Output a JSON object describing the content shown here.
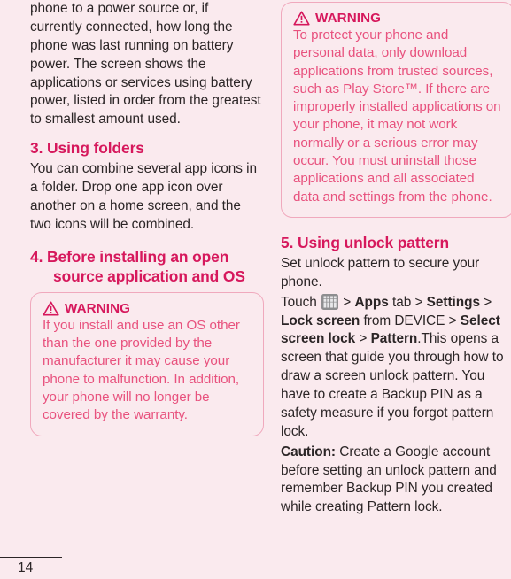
{
  "page": {
    "number": "14",
    "background_color": "#faeaee",
    "heading_color": "#d6185c",
    "body_text_color": "#2b2526",
    "warning_text_color": "#e8527e",
    "warning_border_color": "#f0a9bd"
  },
  "left_column": {
    "continued_paragraph": "phone to a power source or, if currently connected, how long the phone was last running on battery power. The screen shows the applications or services using battery power, listed in order from the greatest to smallest amount used.",
    "section3": {
      "heading": "3. Using folders",
      "paragraph": "You can combine several app icons in a folder. Drop one app icon over another on a home screen, and the two icons will be combined."
    },
    "section4": {
      "heading": "4. Before installing an open source application and OS",
      "warning": {
        "icon": "warning-triangle-icon",
        "label": "WARNING",
        "text": "If you install and use an OS other than the one provided by the manufacturer it may cause your phone to malfunction. In addition, your phone will no longer be covered by the warranty."
      }
    }
  },
  "right_column": {
    "warning": {
      "icon": "warning-triangle-icon",
      "label": "WARNING",
      "text": "To protect your phone and personal data, only download applications from trusted sources, such as Play Store™. If there are improperly installed applications on your phone, it may not work normally or a serious error may occur. You must uninstall those applications and all associated data and settings from the phone."
    },
    "section5": {
      "heading": "5. Using unlock pattern",
      "intro": "Set unlock pattern to secure your phone.",
      "path": {
        "touch_label": "Touch",
        "apps_icon": "apps-grid-icon",
        "sep": ">",
        "step1_bold": "Apps",
        "step1_rest": "tab",
        "step2_bold": "Settings",
        "step3_bold": "Lock screen",
        "step3_rest": "from DEVICE",
        "step4_bold": "Select screen lock",
        "step5_bold": "Pattern",
        "trailing": ".This opens a screen that guide you through how to draw a screen unlock pattern. You have to create a Backup PIN as a safety measure if you forgot pattern lock."
      },
      "caution": {
        "label": "Caution:",
        "text": "Create a Google account before setting an unlock pattern and remember Backup PIN you created while creating Pattern lock."
      }
    }
  }
}
